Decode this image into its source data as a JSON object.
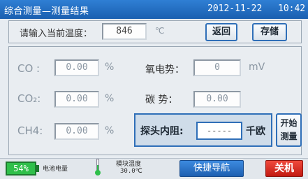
{
  "header": {
    "title": "综合测量—测量结果",
    "date": "2012-11-22",
    "time": "10:42"
  },
  "temperature_input": {
    "label": "请输入当前温度：",
    "value": "846",
    "unit": "℃"
  },
  "actions": {
    "back_label": "返回",
    "save_label": "存储"
  },
  "measurements": {
    "co": {
      "label": "CO  :",
      "value": "0.00",
      "unit": "%"
    },
    "co2": {
      "label": "CO₂:",
      "value": "0.00",
      "unit": "%"
    },
    "ch4": {
      "label": "CH4:",
      "value": "0.00",
      "unit": "%"
    },
    "oxygen_potential": {
      "label": "氧电势：",
      "value": "0",
      "unit": "mV"
    },
    "carbon_potential": {
      "label": "碳   势：",
      "value": "0.00"
    }
  },
  "probe": {
    "label": "探头内阻:",
    "value": "-----",
    "unit": "千欧"
  },
  "start_button": {
    "line1": "开始",
    "line2": "测量"
  },
  "status": {
    "battery_percent": "54%",
    "battery_level": 0.54,
    "battery_label": "电池电量",
    "module_temp_label": "模块温度",
    "module_temp_value": "30.0℃"
  },
  "bottom_actions": {
    "quick_nav_label": "快捷导航",
    "power_off_label": "关机"
  },
  "colors": {
    "title_bar": "#1a5fb0",
    "accent": "#2f6fb8",
    "battery": "#2fbf4a",
    "power_off": "#c21a12"
  },
  "icons": {
    "thermometer": "thermometer-icon",
    "battery": "battery-icon"
  }
}
